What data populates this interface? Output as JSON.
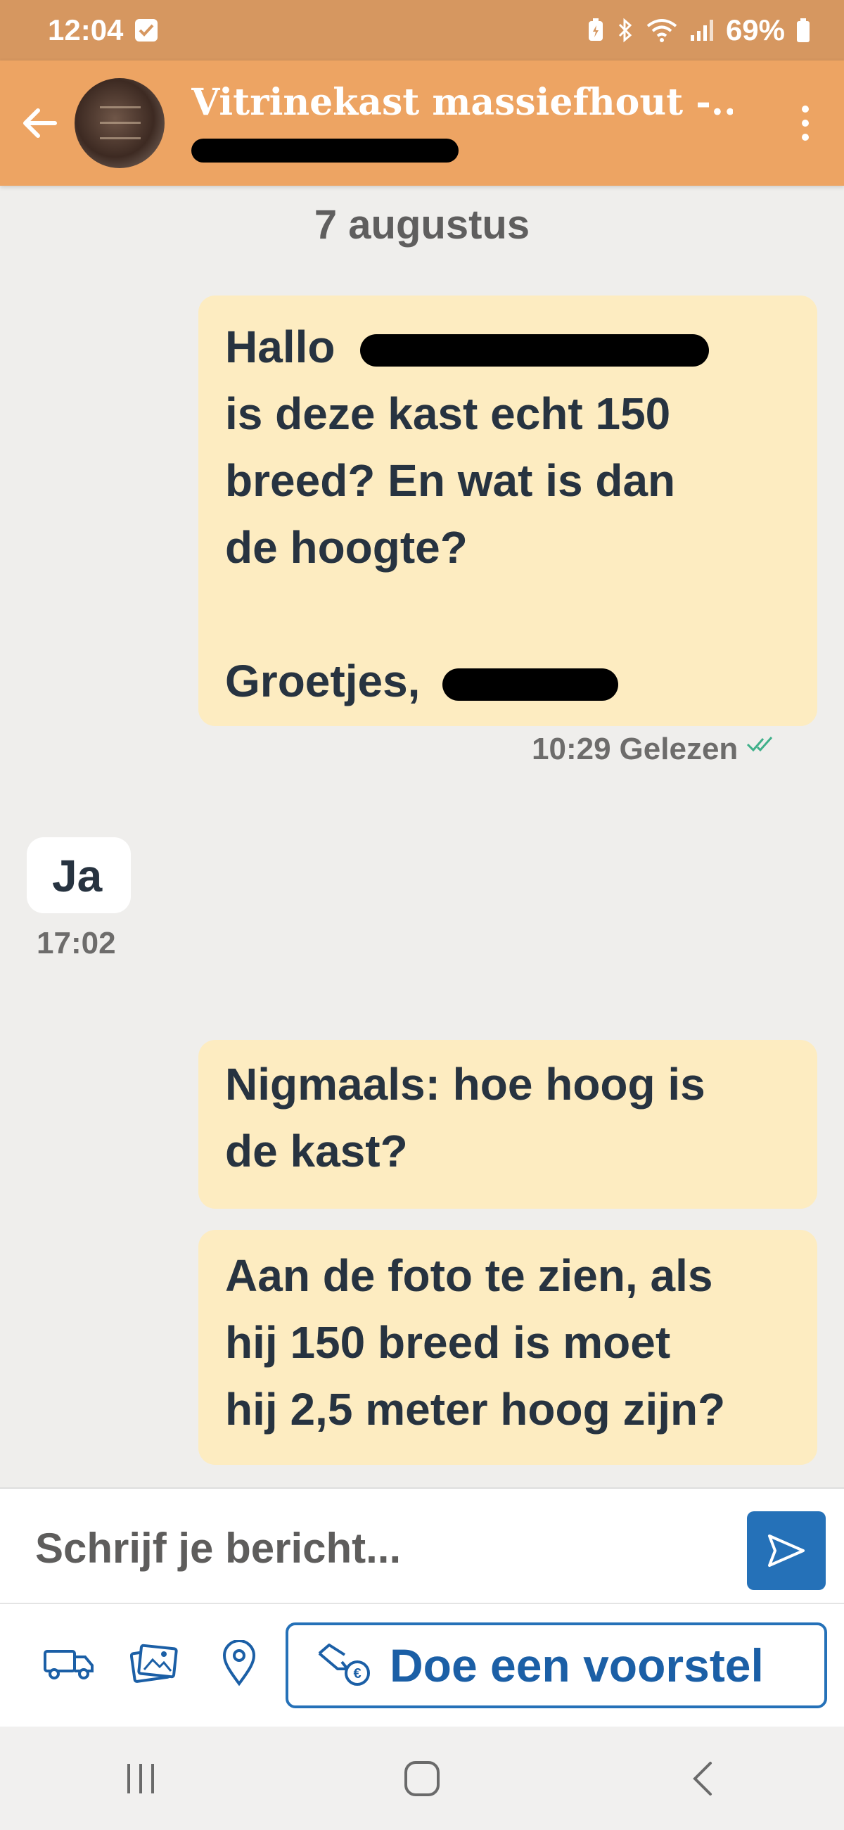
{
  "status_bar": {
    "time": "12:04",
    "battery": "69%"
  },
  "header": {
    "title": "Vitrinekast massiefhout -...",
    "subtitle": "[redacted]"
  },
  "chat": {
    "date_separator": "7 augustus",
    "messages": [
      {
        "direction": "outgoing",
        "lines": [
          "Hallo",
          "is deze kast echt 150",
          "breed? En wat is dan",
          "de hoogte?",
          "",
          "Groetjes,"
        ],
        "time": "10:29",
        "status": "Gelezen"
      },
      {
        "direction": "incoming",
        "lines": [
          "Ja"
        ],
        "time": "17:02"
      },
      {
        "direction": "outgoing",
        "lines": [
          "Nigmaals: hoe hoog is",
          "de kast?"
        ]
      },
      {
        "direction": "outgoing",
        "lines": [
          "Aan de foto te zien, als",
          "hij 150 breed is moet",
          "hij 2,5 meter hoog zijn?"
        ]
      }
    ]
  },
  "composer": {
    "placeholder": "Schrijf je bericht..."
  },
  "actions": {
    "offer_label": "Doe een voorstel",
    "icons": [
      "truck-icon",
      "images-icon",
      "location-icon"
    ]
  },
  "colors": {
    "status_bar": "#d69760",
    "app_bar": "#eda463",
    "outgoing_bubble": "#fdecc1",
    "incoming_bubble": "#ffffff",
    "accent_blue": "#2571b8",
    "read_check": "#3fb08a"
  }
}
